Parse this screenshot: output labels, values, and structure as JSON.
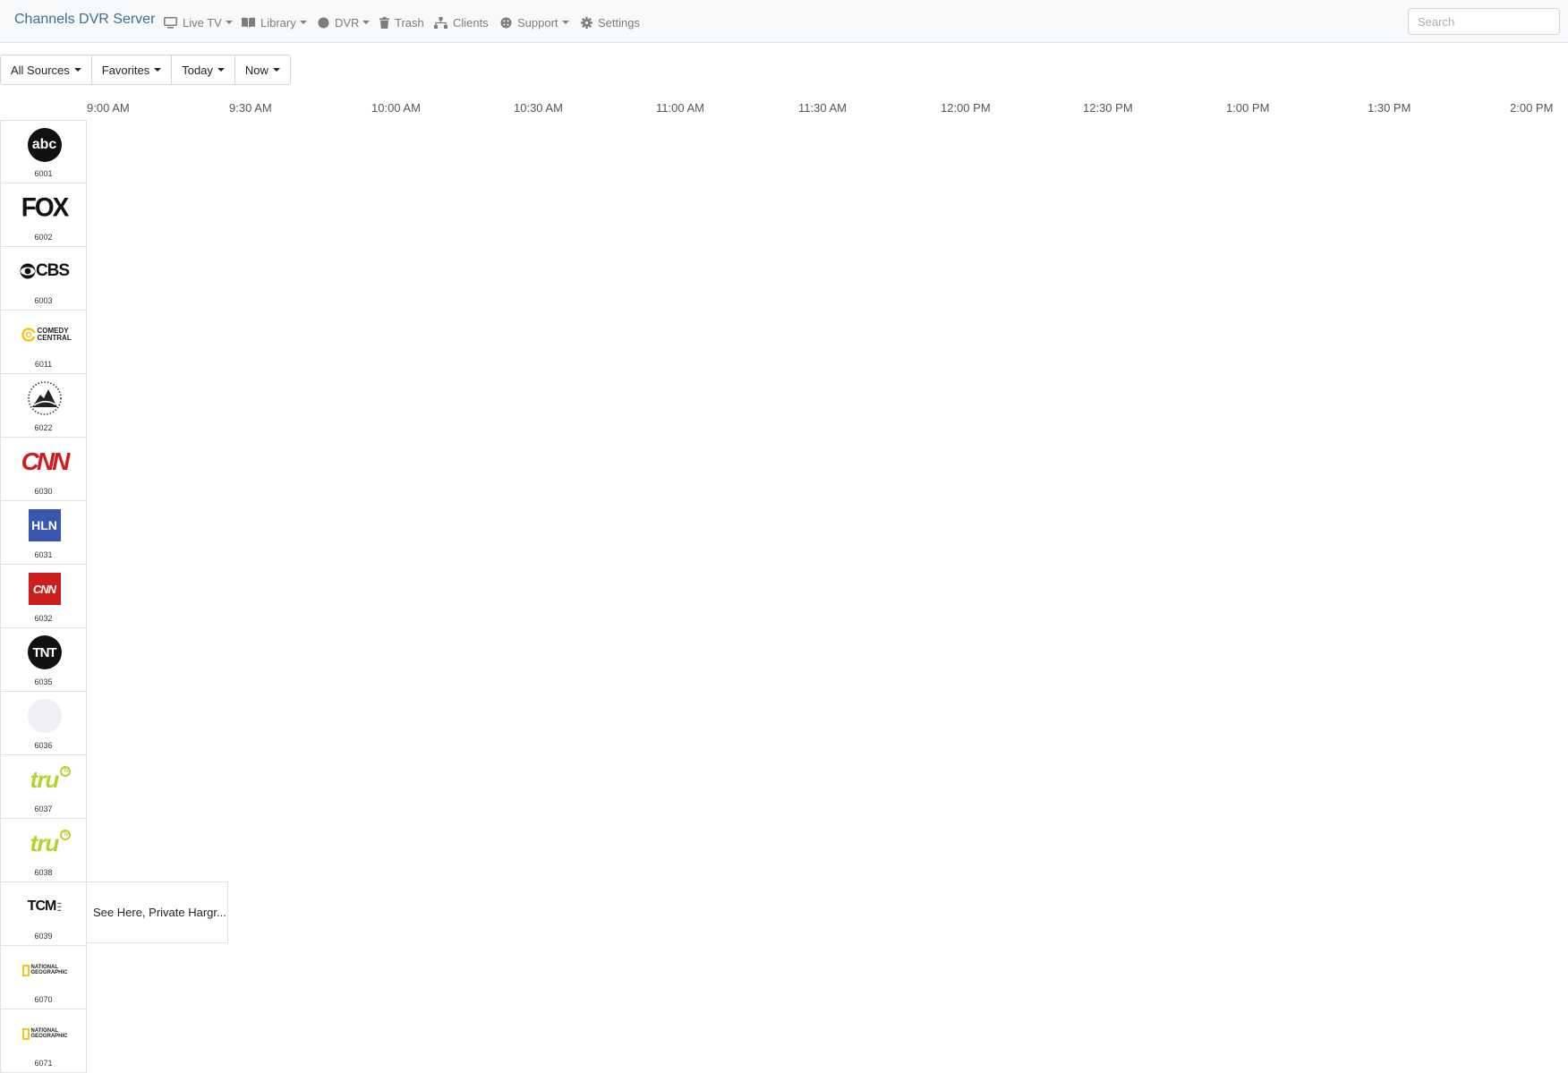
{
  "app": {
    "brand": "Channels DVR Server"
  },
  "nav": {
    "live_tv": "Live TV",
    "library": "Library",
    "dvr": "DVR",
    "trash": "Trash",
    "clients": "Clients",
    "support": "Support",
    "settings": "Settings"
  },
  "search": {
    "placeholder": "Search",
    "value": ""
  },
  "filters": {
    "sources": "All Sources",
    "favorites": "Favorites",
    "day": "Today",
    "time": "Now"
  },
  "timeline": [
    "9:00 AM",
    "9:30 AM",
    "10:00 AM",
    "10:30 AM",
    "11:00 AM",
    "11:30 AM",
    "12:00 PM",
    "12:30 PM",
    "1:00 PM",
    "1:30 PM",
    "2:00 PM"
  ],
  "channels": [
    {
      "number": "6001",
      "logo": "abc-logo",
      "logo_text": "abc"
    },
    {
      "number": "6002",
      "logo": "fox-logo",
      "logo_text": "FOX"
    },
    {
      "number": "6003",
      "logo": "cbs-logo",
      "logo_text": "CBS"
    },
    {
      "number": "6011",
      "logo": "comedy-central-logo",
      "logo_text": "COMEDY CENTRAL"
    },
    {
      "number": "6022",
      "logo": "paramount-network-logo",
      "logo_text": ""
    },
    {
      "number": "6030",
      "logo": "cnn-logo",
      "logo_text": "CNN"
    },
    {
      "number": "6031",
      "logo": "hln-logo",
      "logo_text": "HLN"
    },
    {
      "number": "6032",
      "logo": "cnn-red-box-logo",
      "logo_text": "CNN"
    },
    {
      "number": "6035",
      "logo": "tnt-logo",
      "logo_text": "TNT"
    },
    {
      "number": "6036",
      "logo": "tnt-faded-logo",
      "logo_text": ""
    },
    {
      "number": "6037",
      "logo": "trutv-logo",
      "logo_text": "tru",
      "logo_badge": "TV"
    },
    {
      "number": "6038",
      "logo": "trutv-logo",
      "logo_text": "tru",
      "logo_badge": "TV"
    },
    {
      "number": "6039",
      "logo": "tcm-logo",
      "logo_text": "TCM"
    },
    {
      "number": "6070",
      "logo": "national-geographic-logo",
      "logo_text": "NATIONAL GEOGRAPHIC"
    },
    {
      "number": "6071",
      "logo": "national-geographic-logo",
      "logo_text": "NATIONAL GEOGRAPHIC"
    }
  ],
  "programs": [
    {
      "channel": "6039",
      "title": "See Here, Private Hargr..."
    }
  ],
  "colors": {
    "navbar_bg": "#f8f9fa",
    "brand": "#3a6f96",
    "nav_text": "#7d7d7d",
    "cnn_red": "#cc1e1e",
    "hln_blue": "#3a57b0",
    "trutv_green": "#b7d12f",
    "comedy_central_yellow": "#f2c812",
    "natgeo_yellow": "#f2c812"
  }
}
